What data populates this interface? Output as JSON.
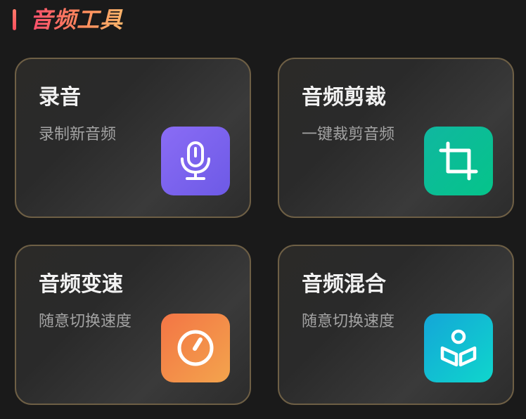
{
  "section": {
    "title": "音频工具"
  },
  "tools": [
    {
      "title": "录音",
      "subtitle": "录制新音频",
      "icon": "microphone-icon",
      "color": "#7b63ee"
    },
    {
      "title": "音频剪裁",
      "subtitle": "一键裁剪音频",
      "icon": "crop-icon",
      "color": "#0bbd95"
    },
    {
      "title": "音频变速",
      "subtitle": "随意切换速度",
      "icon": "speedometer-icon",
      "color": "#f38a49"
    },
    {
      "title": "音频混合",
      "subtitle": "随意切换速度",
      "icon": "mix-icon",
      "color": "#12bdd2"
    }
  ]
}
